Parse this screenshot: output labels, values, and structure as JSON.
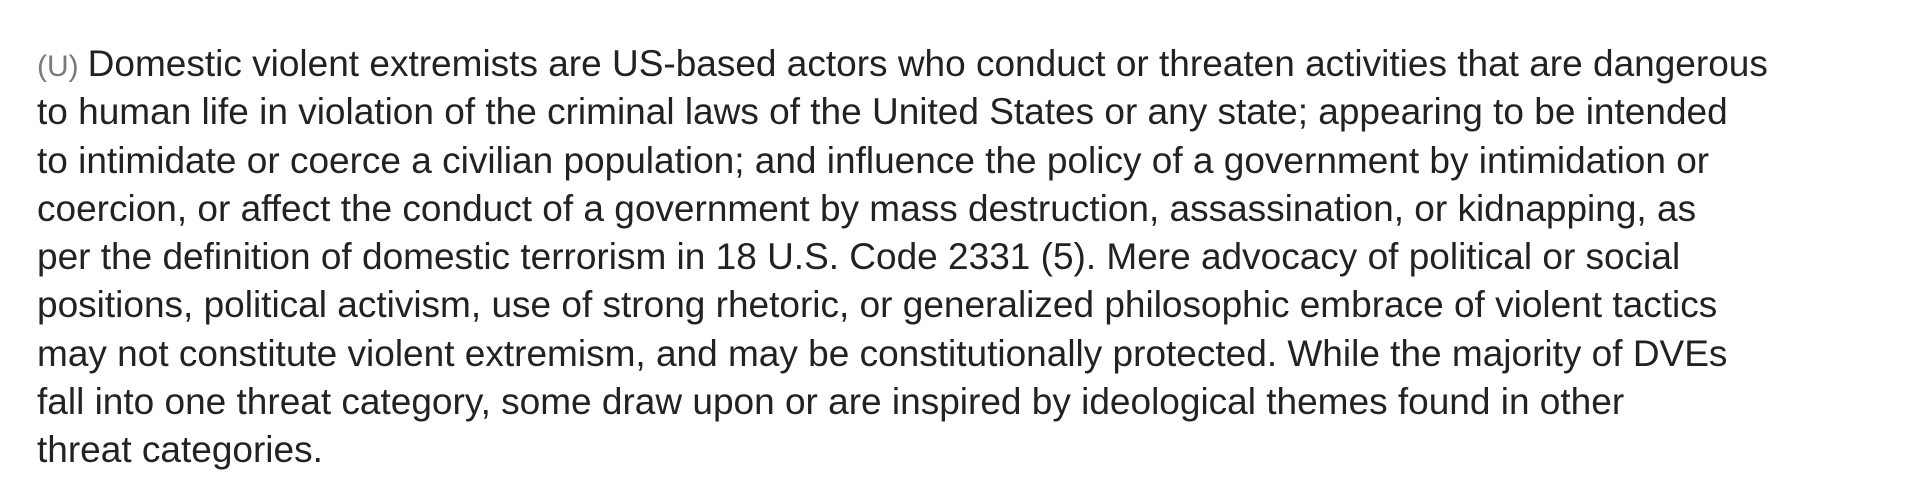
{
  "document": {
    "classification_marking": "(U)",
    "paragraph_lines": [
      "Domestic violent extremists are US-based actors who conduct or threaten activities that are dangerous",
      "to human life in violation of the criminal laws of the United States or any state; appearing to be intended",
      "to intimidate or coerce a civilian population; and influence the policy of a government by intimidation or",
      "coercion, or affect the conduct of a government by mass destruction, assassination, or kidnapping, as",
      "per the definition of domestic terrorism in 18 U.S. Code 2331 (5). Mere advocacy of political or social",
      "positions, political activism, use of strong rhetoric, or generalized philosophic embrace of violent tactics",
      "may not constitute violent extremism, and may be constitutionally protected. While the majority of DVEs",
      "fall into one threat category, some draw upon or are inspired by ideological themes found in other",
      "threat categories."
    ]
  }
}
